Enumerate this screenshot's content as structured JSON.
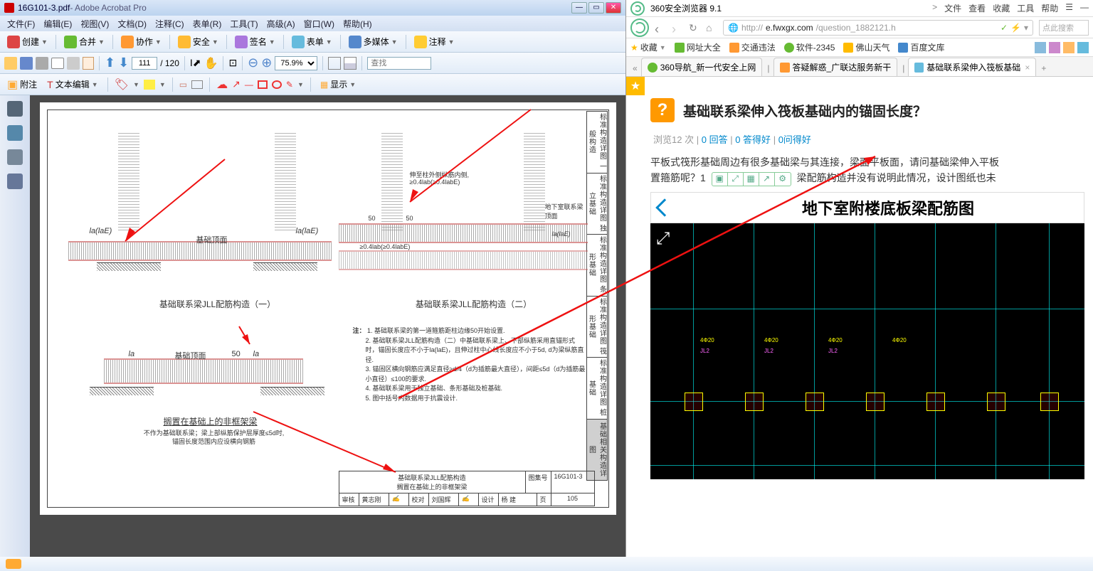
{
  "acrobat": {
    "title_file": "16G101-3.pdf",
    "title_app": " - Adobe Acrobat Pro",
    "menus": [
      "文件(F)",
      "编辑(E)",
      "视图(V)",
      "文档(D)",
      "注释(C)",
      "表单(R)",
      "工具(T)",
      "高级(A)",
      "窗口(W)",
      "帮助(H)"
    ],
    "toolbar1": {
      "create": "创建",
      "combine": "合并",
      "collab": "协作",
      "secure": "安全",
      "sign": "签名",
      "forms": "表单",
      "multimedia": "多媒体",
      "comment": "注释"
    },
    "page_current": "111",
    "page_total": "/ 120",
    "zoom": "75.9%",
    "search_ph": "查找",
    "toolbar3": {
      "note": "附注",
      "textedit": "文本编辑",
      "show": "显示"
    }
  },
  "pdf": {
    "side_labels": [
      "标准构造详图 一般构造",
      "标准构造详图 独立基础",
      "标准构造详图 条形基础",
      "标准构造详图 筏形基础",
      "标准构造详图 桩基础",
      "基础相关构造详图"
    ],
    "diag1_title": "基础联系梁JLL配筋构造（一）",
    "diag2_title": "基础联系梁JLL配筋构造（二）",
    "diag3_title": "搁置在基础上的非框架梁",
    "diag3_sub1": "不作为基础联系梁；梁上部纵筋保护层厚度≤5d时,",
    "diag3_sub2": "锚固长度范围内应设横向钢筋",
    "label_top": "基础顶面",
    "label_side1": "伸至柱外侧纵筋内侧,",
    "label_side2": "≥0.4lab(≥0.4labE)",
    "label_dxs": "地下室联系梁顶面",
    "note_head": "注：",
    "notes": [
      "1. 基础联系梁的第一道箍筋距柱边缘50开始设置.",
      "2. 基础联系梁JLL配筋构造（二）中基础联系梁上、下部纵筋采用直锚形式时，锚固长度应不小于la(laE)，且伸过柱中心线长度应不小于5d, d为梁纵筋直径.",
      "3. 锚固区横向钢筋应满足直径≥d/4（d为插筋最大直径），间距≤5d（d为插筋最小直径）≤100的要求.",
      "4. 基础联系梁用于独立基础、条形基础及桩基础.",
      "5. 图中括号内数据用于抗震设计."
    ],
    "title_block": {
      "main1": "基础联系梁JLL配筋构造",
      "main2": "搁置在基础上的非框架梁",
      "atlas_lbl": "图集号",
      "atlas": "16G101-3",
      "review": "审核",
      "review_name": "黄志刚",
      "proof": "校对",
      "proof_name": "刘国辉",
      "design": "设计",
      "design_name": "杨 建",
      "page_lbl": "页",
      "page": "105"
    },
    "dim_50": "50",
    "dim_la": "la",
    "dim_laE": "la(laE)",
    "dim_04": "≥0.4lab(≥0.4labE)"
  },
  "browser": {
    "app": "360安全浏览器 9.1",
    "top_menu": [
      "文件",
      "查看",
      "收藏",
      "工具",
      "帮助"
    ],
    "url_proto": "http://",
    "url_host": "e.fwxgx.com",
    "url_path": "/question_1882121.h",
    "search_ph": "点此搜索",
    "fav_label": "收藏",
    "favs": [
      "网址大全",
      "交通违法",
      "软件-2345",
      "佛山天气",
      "百度文库"
    ],
    "tabs": [
      {
        "label": "360导航_新一代安全上网"
      },
      {
        "label": "答疑解惑_广联达服务新干"
      },
      {
        "label": "基础联系梁伸入筏板基础"
      }
    ],
    "question": {
      "title": "基础联系梁伸入筏板基础内的锚固长度？",
      "stats_views_lbl": "浏览",
      "stats_views": "12 次",
      "stats_ans": "0 回答",
      "stats_good": "0 答得好",
      "stats_ask": "0问得好",
      "body1": "平板式筏形基础周边有很多基础梁与其连接，梁面平板面，请问基础梁伸入平板",
      "body2": "置箍筋呢？1",
      "body3": "梁配筋构造并没有说明此情况，设计图纸也未",
      "img_title": "地下室附楼底板梁配筋图"
    }
  }
}
